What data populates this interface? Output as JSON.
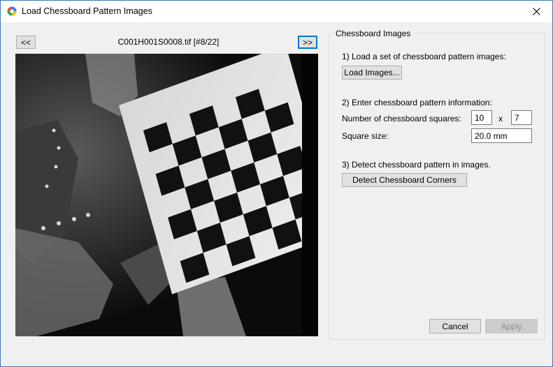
{
  "window": {
    "title": "Load Chessboard Pattern Images",
    "close_icon": "close-icon",
    "app_icon": "app-logo-icon"
  },
  "nav": {
    "prev_label": "<<",
    "next_label": ">>",
    "current_file": "C001H001S0008.tif [#8/22]"
  },
  "panel": {
    "group_title": "Chessboard Images",
    "step1": "1) Load a set of chessboard pattern images:",
    "load_button": "Load Images...",
    "step2": "2) Enter chessboard pattern information:",
    "squares_label": "Number of chessboard squares:",
    "squares_x": "10",
    "squares_sep": "x",
    "squares_y": "7",
    "square_size_label": "Square size:",
    "square_size": "20.0 mm",
    "step3": "3) Detect chessboard pattern in images.",
    "detect_button": "Detect Chessboard Corners"
  },
  "footer": {
    "cancel": "Cancel",
    "apply": "Apply"
  }
}
